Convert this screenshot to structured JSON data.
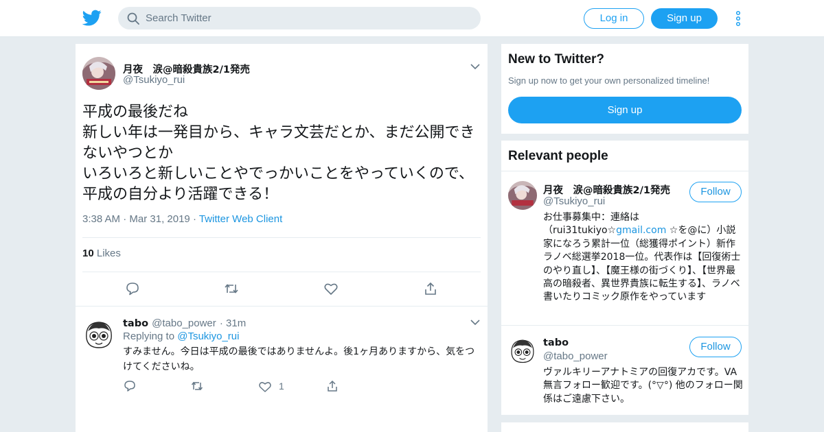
{
  "header": {
    "search_placeholder": "Search Twitter",
    "login_label": "Log in",
    "signup_label": "Sign up"
  },
  "tweet": {
    "author_name": "月夜　涙@暗殺貴族2/1発売",
    "author_handle": "@Tsukiyo_rui",
    "text": "平成の最後だね\n新しい年は一発目から、キャラ文芸だとか、まだ公開できないやつとか\nいろいろと新しいことやでっかいことをやっていくので、平成の自分より活躍できる！",
    "time": "3:38 AM",
    "date": "Mar 31, 2019",
    "source": "Twitter Web Client",
    "like_count": "10",
    "likes_label": "Likes"
  },
  "reply": {
    "author_name": "tabo",
    "author_handle": "@tabo_power",
    "age": "31m",
    "replying_prefix": "Replying to",
    "replying_to": "@Tsukiyo_rui",
    "text": "すみません。今日は平成の最後ではありませんよ。後1ヶ月ありますから、気をつけてくださいね。",
    "like_count": "1"
  },
  "new_to_twitter": {
    "title": "New to Twitter?",
    "subtitle": "Sign up now to get your own personalized timeline!",
    "signup_label": "Sign up"
  },
  "relevant_people": {
    "title": "Relevant people",
    "people": [
      {
        "name": "月夜　涙@暗殺貴族2/1発売",
        "handle": "@Tsukiyo_rui",
        "follow_label": "Follow",
        "bio_before": "お仕事募集中：連絡は（rui31tukiyo☆",
        "bio_link": "gmail.com",
        "bio_after": " ☆を@に）小説家になろう累計一位（総獲得ポイント）新作ラノベ総選挙2018一位。代表作は【回復術士のやり直し】、【魔王様の街づくり】、【世界最高の暗殺者、異世界貴族に転生する】、ラノベ書いたりコミック原作をやっています"
      },
      {
        "name": "tabo",
        "handle": "@tabo_power",
        "follow_label": "Follow",
        "bio": "ヴァルキリーアナトミアの回復アカです。VA無言フォロー歓迎です。(°▽°) 他のフォロー関係はご遠慮下さい。"
      }
    ]
  },
  "colors": {
    "brand": "#1da1f2",
    "link": "#1b95e0",
    "muted": "#657786",
    "background": "#e6ecf0"
  }
}
